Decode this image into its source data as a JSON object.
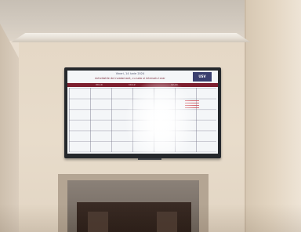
{
  "tv": {
    "title": "Vineri, 14 Iunie 2024",
    "subtitle": "Activitatile de invatamant, cu sala si intervalul orar",
    "logo": "USV",
    "headers": [
      "09-10",
      "10-12",
      "12-14"
    ]
  },
  "colors": {
    "wall": "#e8dccb",
    "tv_bezel": "#25282c",
    "header_bar": "#7d1f2f",
    "door": "#2a1e19"
  }
}
